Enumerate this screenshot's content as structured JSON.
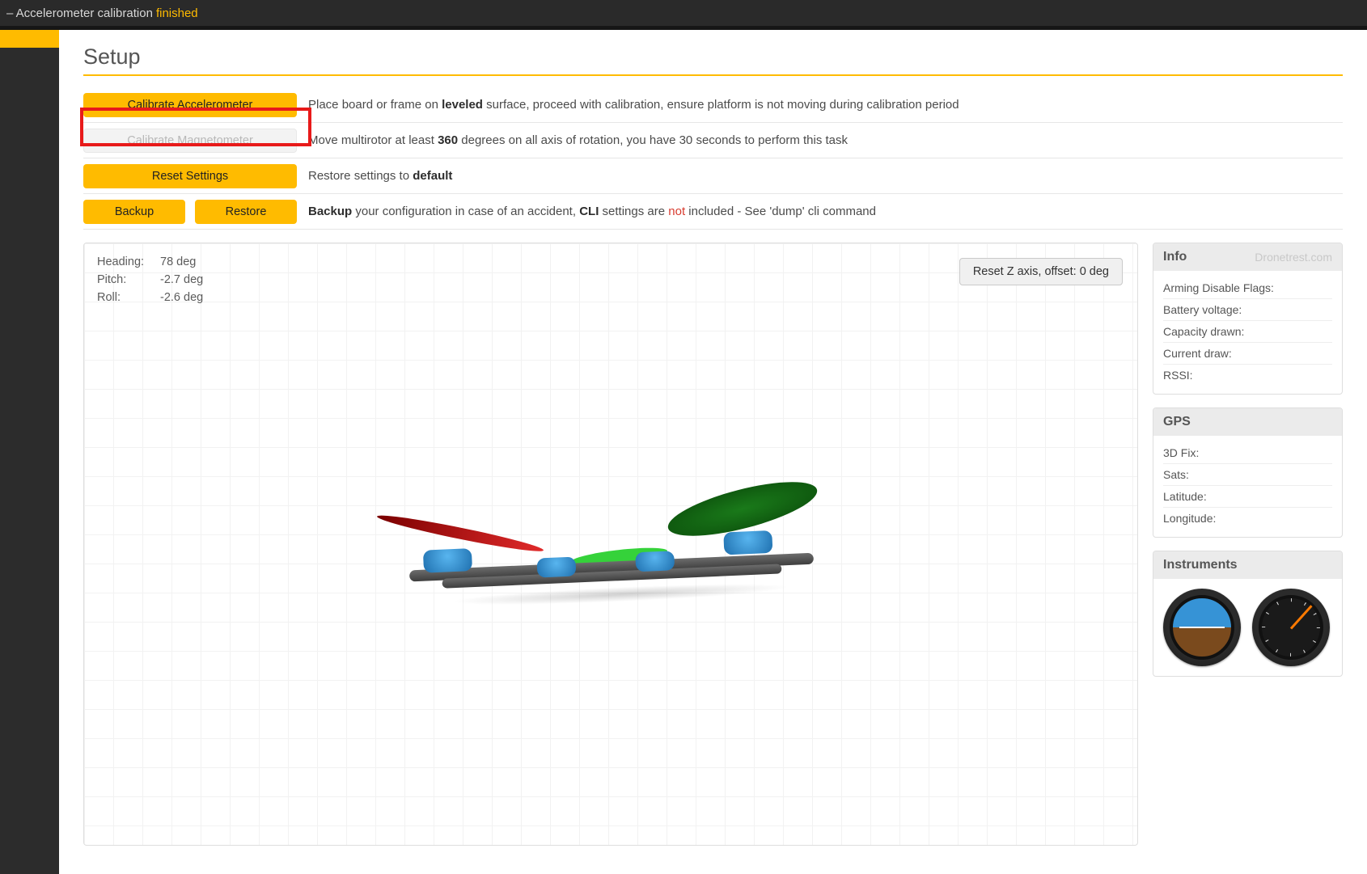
{
  "statusbar": {
    "prefix": "– Accelerometer calibration",
    "suffix": "finished"
  },
  "page": {
    "title": "Setup"
  },
  "actions": {
    "calibrate_accel": {
      "label": "Calibrate Accelerometer"
    },
    "calibrate_mag": {
      "label": "Calibrate Magnetometer"
    },
    "reset": {
      "label": "Reset Settings"
    },
    "backup": {
      "label": "Backup"
    },
    "restore": {
      "label": "Restore"
    }
  },
  "descriptions": {
    "accel_pre": "Place board or frame on ",
    "accel_bold": "leveled",
    "accel_post": " surface, proceed with calibration, ensure platform is not moving during calibration period",
    "mag_pre": "Move multirotor at least ",
    "mag_bold": "360",
    "mag_post": " degrees on all axis of rotation, you have 30 seconds to perform this task",
    "reset_pre": "Restore settings to ",
    "reset_bold": "default",
    "backup_b1": "Backup",
    "backup_mid": " your configuration in case of an accident, ",
    "backup_b2": "CLI",
    "backup_mid2": " settings are ",
    "backup_red": "not",
    "backup_post": " included - See 'dump' cli command"
  },
  "attitude": {
    "heading_label": "Heading:",
    "heading_value": "78 deg",
    "pitch_label": "Pitch:",
    "pitch_value": "-2.7 deg",
    "roll_label": "Roll:",
    "roll_value": "-2.6 deg"
  },
  "reset_z_label": "Reset Z axis, offset: 0 deg",
  "info_panel": {
    "title": "Info",
    "watermark": "Dronetrest.com",
    "rows": [
      "Arming Disable Flags:",
      "Battery voltage:",
      "Capacity drawn:",
      "Current draw:",
      "RSSI:"
    ]
  },
  "gps_panel": {
    "title": "GPS",
    "rows": [
      "3D Fix:",
      "Sats:",
      "Latitude:",
      "Longitude:"
    ]
  },
  "instruments_panel": {
    "title": "Instruments"
  }
}
